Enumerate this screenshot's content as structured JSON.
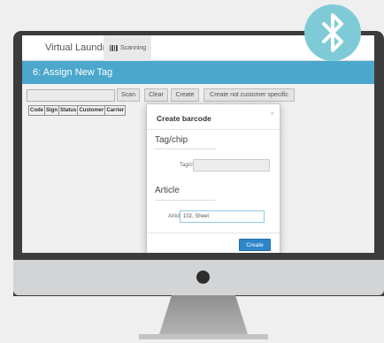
{
  "app": {
    "brand": "Virtual Laundry",
    "nav_tab_label": "Scanning"
  },
  "page": {
    "title": "6: Assign New Tag"
  },
  "toolbar": {
    "scan_input_value": "",
    "scan_label": "Scan",
    "clear_label": "Clear",
    "create_label": "Create",
    "create_not_customer_specific_label": "Create not customer specific"
  },
  "grid": {
    "columns": [
      "Code",
      "Sign",
      "Status",
      "Customer",
      "Carrier"
    ]
  },
  "modal": {
    "title": "Create barcode",
    "close_symbol": "×",
    "tag_section_title": "Tag/chip",
    "tag_field_label": "Tag/chip",
    "tag_field_value": "",
    "article_section_title": "Article",
    "article_field_label": "Article",
    "article_field_value": "102, Sheet",
    "create_button_label": "Create"
  },
  "icons": {
    "nav_tab_icon": "barcode-icon",
    "badge_icon": "bluetooth-icon"
  },
  "colors": {
    "banner": "#4ba7cb",
    "primary_button": "#2d86c8",
    "bluetooth_badge": "#7ecbd7"
  }
}
